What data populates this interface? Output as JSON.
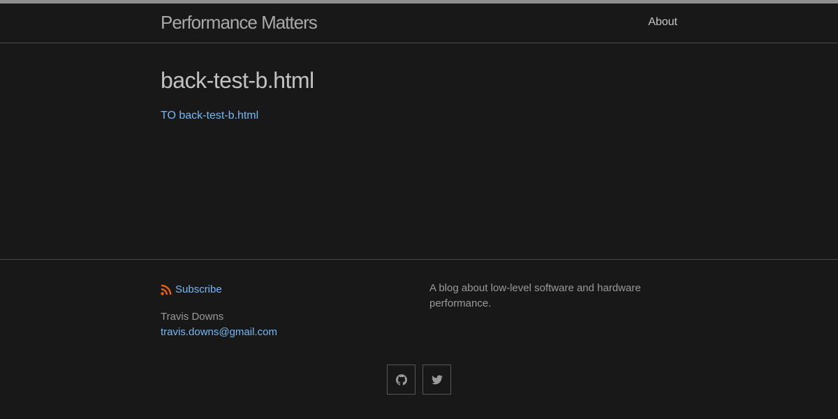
{
  "header": {
    "site_title": "Performance Matters",
    "nav": [
      {
        "label": "About"
      }
    ]
  },
  "main": {
    "title": "back-test-b.html",
    "link_text": "TO back-test-b.html"
  },
  "footer": {
    "subscribe_label": "Subscribe",
    "author_name": "Travis Downs",
    "author_email": "travis.downs@gmail.com",
    "description": "A blog about low-level software and hardware performance.",
    "social_icons": [
      "github-icon",
      "twitter-icon"
    ]
  },
  "colors": {
    "background": "#181818",
    "link": "#79b8f3",
    "rss": "#e8650e",
    "text": "#9a9a9a"
  }
}
